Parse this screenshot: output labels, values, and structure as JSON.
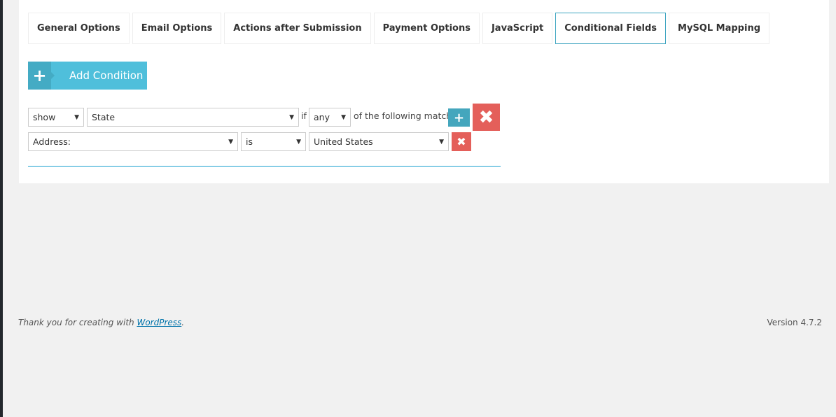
{
  "tabs": [
    "General Options",
    "Email Options",
    "Actions after Submission",
    "Payment Options",
    "JavaScript",
    "Conditional Fields",
    "MySQL Mapping"
  ],
  "active_tab": "Conditional Fields",
  "add_condition": {
    "icon": "plus-icon",
    "label": "Add Condition"
  },
  "condition": {
    "action": "show",
    "field": "State",
    "if_label": "if",
    "match": "any",
    "match_text": "of the following match:"
  },
  "rule": {
    "field": "Address:",
    "operator": "is",
    "value": "United States"
  },
  "colors": {
    "accent": "#4fbfdb",
    "delete": "#e45f5a",
    "tab_active_border": "#3ea5c1"
  },
  "footer": {
    "prefix": "Thank you for creating with ",
    "link": "WordPress",
    "suffix": ".",
    "version": "Version 4.7.2"
  }
}
